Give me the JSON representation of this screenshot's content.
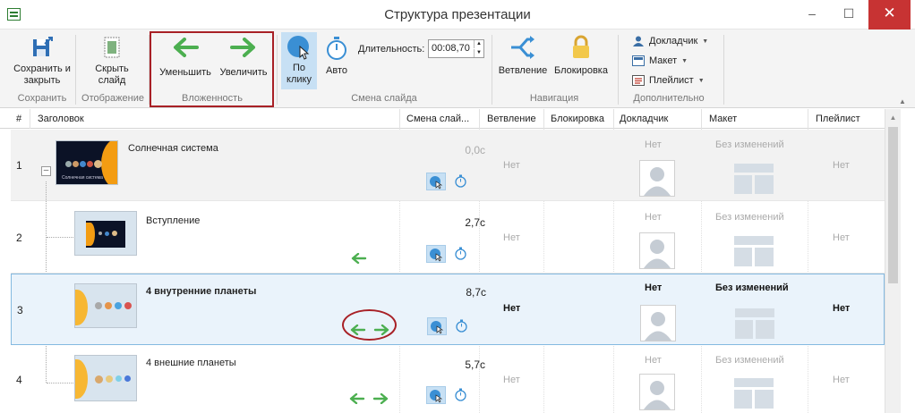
{
  "window": {
    "title": "Структура презентации",
    "minimize": "–",
    "maximize": "☐",
    "close": "✕"
  },
  "ribbon": {
    "save_close": "Сохранить и закрыть",
    "hide_slide": "Скрыть слайд",
    "decrease": "Уменьшить",
    "increase": "Увеличить",
    "on_click": "По клику",
    "auto": "Авто",
    "duration_label": "Длительность:",
    "duration_value": "00:08,70",
    "branching": "Ветвление",
    "lock": "Блокировка",
    "presenter": "Докладчик",
    "layout": "Макет",
    "playlist": "Плейлист",
    "groups": {
      "save": "Сохранить",
      "display": "Отображение",
      "nesting": "Вложенность",
      "slide_change": "Смена слайда",
      "navigation": "Навигация",
      "additional": "Дополнительно"
    }
  },
  "columns": {
    "num": "#",
    "title": "Заголовок",
    "slide_change": "Смена слай...",
    "branching": "Ветвление",
    "lock": "Блокировка",
    "presenter": "Докладчик",
    "layout": "Макет",
    "playlist": "Плейлист"
  },
  "rows": [
    {
      "num": "1",
      "title": "Солнечная система",
      "duration": "0,0с",
      "branching": "Нет",
      "presenter": "Нет",
      "layout": "Без изменений",
      "playlist": "Нет",
      "thumb_caption": "Солнечная система"
    },
    {
      "num": "2",
      "title": "Вступление",
      "duration": "2,7с",
      "branching": "Нет",
      "presenter": "Нет",
      "layout": "Без изменений",
      "playlist": "Нет"
    },
    {
      "num": "3",
      "title": "4 внутренние планеты",
      "duration": "8,7с",
      "branching": "Нет",
      "presenter": "Нет",
      "layout": "Без изменений",
      "playlist": "Нет"
    },
    {
      "num": "4",
      "title": "4 внешние планеты",
      "duration": "5,7с",
      "branching": "Нет",
      "presenter": "Нет",
      "layout": "Без изменений",
      "playlist": "Нет"
    }
  ],
  "colors": {
    "accent_blue": "#3a8fd4",
    "arrow_green": "#4caf50",
    "highlight_red": "#a82026",
    "selected_row": "#eaf3fb"
  },
  "icons": [
    "save-icon",
    "hide-slide-icon",
    "arrow-left-icon",
    "arrow-right-icon",
    "cursor-click-icon",
    "stopwatch-icon",
    "branch-icon",
    "lock-icon",
    "person-icon",
    "layout-icon",
    "playlist-icon",
    "avatar-icon"
  ]
}
